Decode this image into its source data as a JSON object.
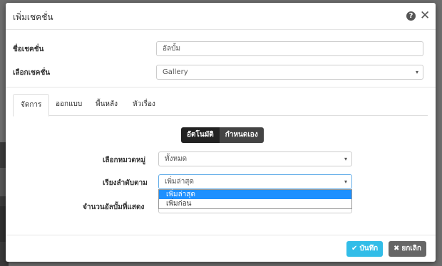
{
  "modal": {
    "title": "เพิ่มเชคชั่น",
    "help_icon": "question-circle",
    "close_icon": "close-x"
  },
  "form": {
    "section_name_label": "ชื่อเชคชั่น",
    "section_name_value": "อัลบั้ม",
    "section_type_label": "เลือกเชคชั่น",
    "section_type_value": "Gallery"
  },
  "tabs": [
    "จัดการ",
    "ออกแบบ",
    "พื้นหลัง",
    "หัวเรื่อง"
  ],
  "active_tab": "จัดการ",
  "mode_toggle": {
    "auto": "อัตโนมัติ",
    "custom": "กำหนดเอง",
    "selected": "อัตโนมัติ"
  },
  "settings": {
    "category_label": "เลือกหมวดหมู่",
    "category_value": "ทั้งหมด",
    "sort_label": "เรียงลำดับตาม",
    "sort_value": "เพิ่มล่าสุด",
    "sort_options": [
      "เพิ่มล่าสุด",
      "เพิ่มก่อน"
    ],
    "count_label": "จำนวนอัลบั้มที่แสดง"
  },
  "footer": {
    "save_label": "บันทึก",
    "cancel_label": "ยกเลิก"
  },
  "colors": {
    "save": "#32bde8",
    "cancel": "#666666",
    "highlight": "#1e90ff"
  }
}
